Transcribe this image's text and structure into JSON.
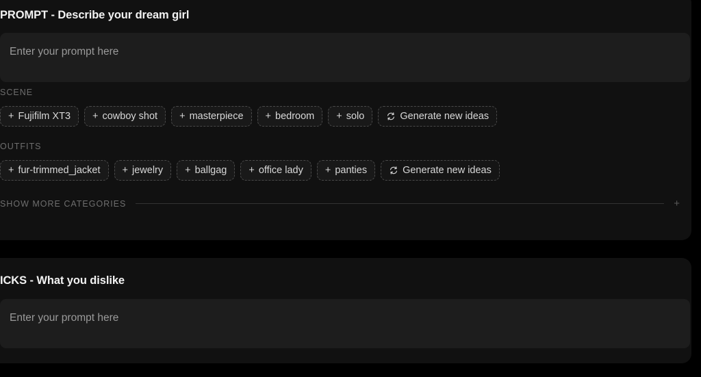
{
  "prompt_section": {
    "title": "PROMPT - Describe your dream girl",
    "textarea": {
      "value": "",
      "placeholder": "Enter your prompt here"
    },
    "categories": [
      {
        "label": "SCENE",
        "tags": [
          {
            "prefix": "+",
            "label": "Fujifilm XT3"
          },
          {
            "prefix": "+",
            "label": "cowboy shot"
          },
          {
            "prefix": "+",
            "label": "masterpiece"
          },
          {
            "prefix": "+",
            "label": "bedroom"
          },
          {
            "prefix": "+",
            "label": "solo"
          }
        ],
        "generate_label": "Generate new ideas",
        "generate_icon": "refresh-icon"
      },
      {
        "label": "OUTFITS",
        "tags": [
          {
            "prefix": "+",
            "label": "fur-trimmed_jacket"
          },
          {
            "prefix": "+",
            "label": "jewelry"
          },
          {
            "prefix": "+",
            "label": "ballgag"
          },
          {
            "prefix": "+",
            "label": "office lady"
          },
          {
            "prefix": "+",
            "label": "panties"
          }
        ],
        "generate_label": "Generate new ideas",
        "generate_icon": "refresh-icon"
      }
    ],
    "show_more": {
      "label": "SHOW MORE CATEGORIES",
      "plus": "+"
    }
  },
  "icks_section": {
    "title": "ICKS - What you dislike",
    "textarea": {
      "value": "",
      "placeholder": "Enter your prompt here"
    }
  },
  "colors": {
    "page_background": "#000000",
    "card_background": "#111111",
    "input_background": "#1d1d1d",
    "tag_background": "#191919",
    "tag_border": "#4a4a4a",
    "label_text": "#6e6e6e",
    "title_text": "#f2f2f2",
    "placeholder_text": "#9a9a9a",
    "divider": "#333333"
  }
}
